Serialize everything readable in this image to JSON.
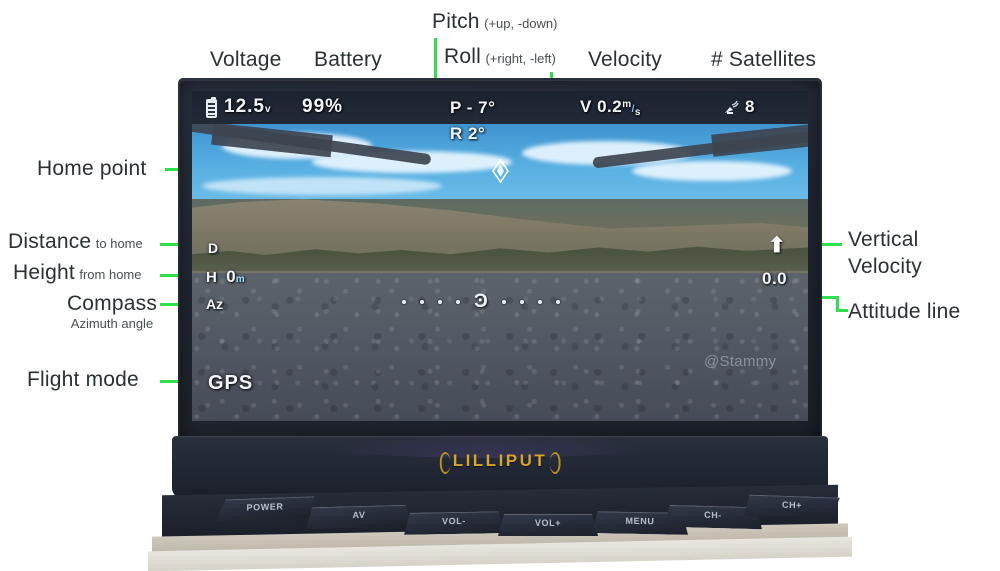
{
  "annotations": {
    "voltage": {
      "label": "Voltage"
    },
    "battery": {
      "label": "Battery"
    },
    "pitch": {
      "label": "Pitch",
      "note": "(+up, -down)"
    },
    "roll": {
      "label": "Roll",
      "note": "(+right, -left)"
    },
    "velocity": {
      "label": "Velocity"
    },
    "satellites": {
      "label": "# Satellites"
    },
    "home_point": {
      "label": "Home point"
    },
    "distance": {
      "label": "Distance",
      "note": "to home"
    },
    "height": {
      "label": "Height",
      "note": "from home"
    },
    "compass": {
      "label": "Compass",
      "note": "Azimuth angle"
    },
    "flight_mode": {
      "label": "Flight mode"
    },
    "vertical_velocity": {
      "line1": "Vertical",
      "line2": "Velocity"
    },
    "attitude_line": {
      "label": "Attitude line"
    }
  },
  "osd": {
    "voltage_value": "12.5",
    "voltage_unit": "v",
    "battery_percent": "99%",
    "pitch_label": "P",
    "pitch_value": "- 7°",
    "roll_label": "R",
    "roll_value": "2°",
    "velocity_label": "V",
    "velocity_value": "0.2",
    "velocity_unit_num": "m",
    "velocity_unit_den": "s",
    "satellite_count": "8",
    "distance_label": "D",
    "height_label": "H",
    "height_value": "0",
    "height_unit": "m",
    "azimuth_label": "Az",
    "vertical_velocity_value": "0.0",
    "flight_mode_value": "GPS",
    "watermark": "@Stammy"
  },
  "monitor": {
    "brand": "LILLIPUT",
    "buttons": [
      {
        "label": "POWER"
      },
      {
        "label": "AV"
      },
      {
        "label": "VOL-"
      },
      {
        "label": "VOL+"
      },
      {
        "label": "MENU"
      },
      {
        "label": "CH-"
      },
      {
        "label": "CH+"
      }
    ]
  },
  "colors": {
    "leader_green": "#2ee04a",
    "brand_gold": "#d4a629",
    "osd_white": "#f2f6fb"
  }
}
